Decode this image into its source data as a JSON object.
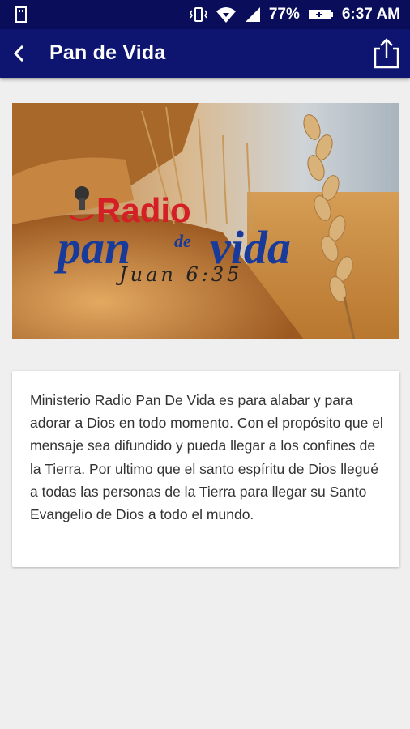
{
  "status_bar": {
    "battery": "77%",
    "time": "6:37 AM",
    "icons": [
      "usb-icon",
      "vibrate-icon",
      "wifi-icon",
      "signal-icon",
      "battery-icon"
    ]
  },
  "app_bar": {
    "title": "Pan de Vida",
    "back_icon": "chevron-left-icon",
    "share_icon": "share-icon",
    "color": "#0d1570"
  },
  "banner": {
    "logo_line1": "Radio",
    "logo_line2_a": "pan",
    "logo_line2_b": "de",
    "logo_line2_c": "vida",
    "verse": "Juan 6:35"
  },
  "description": {
    "text": "Ministerio Radio Pan De Vida es para alabar y para adorar a Dios en todo momento. Con el propósito que el mensaje sea difundido y pueda llegar a los confines de la Tierra. Por ultimo que el santo espíritu de Dios llegué a todas las personas de la Tierra para llegar su Santo Evangelio de Dios a todo el mundo."
  }
}
